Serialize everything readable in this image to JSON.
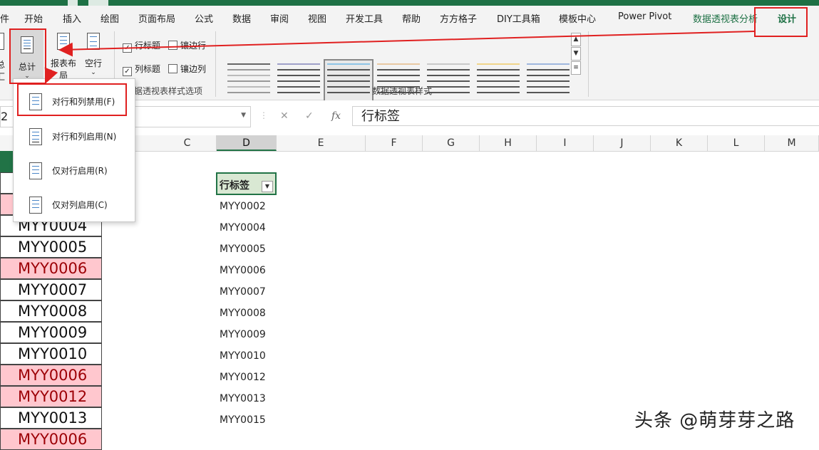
{
  "ribbon_tabs": [
    "开始",
    "插入",
    "绘图",
    "页面布局",
    "公式",
    "数据",
    "审阅",
    "视图",
    "开发工具",
    "帮助",
    "方方格子",
    "DIY工具箱",
    "模板中心",
    "Power Pivot",
    "数据透视表分析",
    "设计"
  ],
  "ribbon_tab_partial": "件",
  "buttons": {
    "subtotal_partial": "总汇",
    "grand_total": "总计",
    "report_layout_line1": "报表布",
    "report_layout_line2": "局",
    "blank_rows": "空行"
  },
  "style_options": {
    "row_headers": "行标题",
    "column_headers": "列标题",
    "banded_rows": "镶边行",
    "banded_columns": "镶边列",
    "group_label": "据透视表样式选项"
  },
  "styles_group_label": "数据透视表样式",
  "dropdown_items": [
    "对行和列禁用(F)",
    "对行和列启用(N)",
    "仅对行启用(R)",
    "仅对列启用(C)"
  ],
  "formula_bar": {
    "cancel": "✕",
    "enter": "✓",
    "fx": "fx",
    "content": "行标签",
    "namebox_partial": "2"
  },
  "columns": [
    "C",
    "D",
    "E",
    "F",
    "G",
    "H",
    "I",
    "J",
    "K",
    "L",
    "M"
  ],
  "selected_column": "D",
  "left_column": [
    {
      "text": "MYY0004",
      "style": "normal"
    },
    {
      "text": "MYY0005",
      "style": "normal"
    },
    {
      "text": "MYY0006",
      "style": "pink"
    },
    {
      "text": "MYY0007",
      "style": "normal"
    },
    {
      "text": "MYY0008",
      "style": "normal"
    },
    {
      "text": "MYY0009",
      "style": "normal"
    },
    {
      "text": "MYY0010",
      "style": "normal"
    },
    {
      "text": "MYY0006",
      "style": "pink"
    },
    {
      "text": "MYY0012",
      "style": "pink"
    },
    {
      "text": "MYY0013",
      "style": "normal"
    },
    {
      "text": "MYY0006",
      "style": "pink"
    }
  ],
  "pivot": {
    "header": "行标签",
    "items": [
      "MYY0002",
      "MYY0004",
      "MYY0005",
      "MYY0006",
      "MYY0007",
      "MYY0008",
      "MYY0009",
      "MYY0010",
      "MYY0012",
      "MYY0013",
      "MYY0015"
    ]
  },
  "watermark": "头条 @萌芽芽之路",
  "colors": {
    "accent": "#1e7145",
    "highlight": "#e02020",
    "pink_fill": "#ffc7ce",
    "pink_text": "#9c0006"
  }
}
